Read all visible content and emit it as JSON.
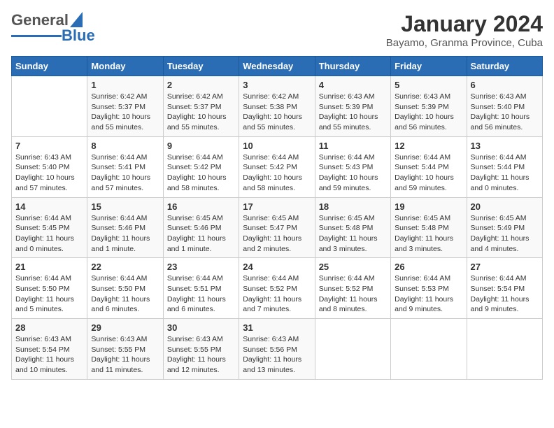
{
  "header": {
    "logo_general": "General",
    "logo_blue": "Blue",
    "title": "January 2024",
    "subtitle": "Bayamo, Granma Province, Cuba"
  },
  "days_of_week": [
    "Sunday",
    "Monday",
    "Tuesday",
    "Wednesday",
    "Thursday",
    "Friday",
    "Saturday"
  ],
  "weeks": [
    [
      {
        "day": "",
        "info": ""
      },
      {
        "day": "1",
        "info": "Sunrise: 6:42 AM\nSunset: 5:37 PM\nDaylight: 10 hours\nand 55 minutes."
      },
      {
        "day": "2",
        "info": "Sunrise: 6:42 AM\nSunset: 5:37 PM\nDaylight: 10 hours\nand 55 minutes."
      },
      {
        "day": "3",
        "info": "Sunrise: 6:42 AM\nSunset: 5:38 PM\nDaylight: 10 hours\nand 55 minutes."
      },
      {
        "day": "4",
        "info": "Sunrise: 6:43 AM\nSunset: 5:39 PM\nDaylight: 10 hours\nand 55 minutes."
      },
      {
        "day": "5",
        "info": "Sunrise: 6:43 AM\nSunset: 5:39 PM\nDaylight: 10 hours\nand 56 minutes."
      },
      {
        "day": "6",
        "info": "Sunrise: 6:43 AM\nSunset: 5:40 PM\nDaylight: 10 hours\nand 56 minutes."
      }
    ],
    [
      {
        "day": "7",
        "info": "Sunrise: 6:43 AM\nSunset: 5:40 PM\nDaylight: 10 hours\nand 57 minutes."
      },
      {
        "day": "8",
        "info": "Sunrise: 6:44 AM\nSunset: 5:41 PM\nDaylight: 10 hours\nand 57 minutes."
      },
      {
        "day": "9",
        "info": "Sunrise: 6:44 AM\nSunset: 5:42 PM\nDaylight: 10 hours\nand 58 minutes."
      },
      {
        "day": "10",
        "info": "Sunrise: 6:44 AM\nSunset: 5:42 PM\nDaylight: 10 hours\nand 58 minutes."
      },
      {
        "day": "11",
        "info": "Sunrise: 6:44 AM\nSunset: 5:43 PM\nDaylight: 10 hours\nand 59 minutes."
      },
      {
        "day": "12",
        "info": "Sunrise: 6:44 AM\nSunset: 5:44 PM\nDaylight: 10 hours\nand 59 minutes."
      },
      {
        "day": "13",
        "info": "Sunrise: 6:44 AM\nSunset: 5:44 PM\nDaylight: 11 hours\nand 0 minutes."
      }
    ],
    [
      {
        "day": "14",
        "info": "Sunrise: 6:44 AM\nSunset: 5:45 PM\nDaylight: 11 hours\nand 0 minutes."
      },
      {
        "day": "15",
        "info": "Sunrise: 6:44 AM\nSunset: 5:46 PM\nDaylight: 11 hours\nand 1 minute."
      },
      {
        "day": "16",
        "info": "Sunrise: 6:45 AM\nSunset: 5:46 PM\nDaylight: 11 hours\nand 1 minute."
      },
      {
        "day": "17",
        "info": "Sunrise: 6:45 AM\nSunset: 5:47 PM\nDaylight: 11 hours\nand 2 minutes."
      },
      {
        "day": "18",
        "info": "Sunrise: 6:45 AM\nSunset: 5:48 PM\nDaylight: 11 hours\nand 3 minutes."
      },
      {
        "day": "19",
        "info": "Sunrise: 6:45 AM\nSunset: 5:48 PM\nDaylight: 11 hours\nand 3 minutes."
      },
      {
        "day": "20",
        "info": "Sunrise: 6:45 AM\nSunset: 5:49 PM\nDaylight: 11 hours\nand 4 minutes."
      }
    ],
    [
      {
        "day": "21",
        "info": "Sunrise: 6:44 AM\nSunset: 5:50 PM\nDaylight: 11 hours\nand 5 minutes."
      },
      {
        "day": "22",
        "info": "Sunrise: 6:44 AM\nSunset: 5:50 PM\nDaylight: 11 hours\nand 6 minutes."
      },
      {
        "day": "23",
        "info": "Sunrise: 6:44 AM\nSunset: 5:51 PM\nDaylight: 11 hours\nand 6 minutes."
      },
      {
        "day": "24",
        "info": "Sunrise: 6:44 AM\nSunset: 5:52 PM\nDaylight: 11 hours\nand 7 minutes."
      },
      {
        "day": "25",
        "info": "Sunrise: 6:44 AM\nSunset: 5:52 PM\nDaylight: 11 hours\nand 8 minutes."
      },
      {
        "day": "26",
        "info": "Sunrise: 6:44 AM\nSunset: 5:53 PM\nDaylight: 11 hours\nand 9 minutes."
      },
      {
        "day": "27",
        "info": "Sunrise: 6:44 AM\nSunset: 5:54 PM\nDaylight: 11 hours\nand 9 minutes."
      }
    ],
    [
      {
        "day": "28",
        "info": "Sunrise: 6:43 AM\nSunset: 5:54 PM\nDaylight: 11 hours\nand 10 minutes."
      },
      {
        "day": "29",
        "info": "Sunrise: 6:43 AM\nSunset: 5:55 PM\nDaylight: 11 hours\nand 11 minutes."
      },
      {
        "day": "30",
        "info": "Sunrise: 6:43 AM\nSunset: 5:55 PM\nDaylight: 11 hours\nand 12 minutes."
      },
      {
        "day": "31",
        "info": "Sunrise: 6:43 AM\nSunset: 5:56 PM\nDaylight: 11 hours\nand 13 minutes."
      },
      {
        "day": "",
        "info": ""
      },
      {
        "day": "",
        "info": ""
      },
      {
        "day": "",
        "info": ""
      }
    ]
  ]
}
